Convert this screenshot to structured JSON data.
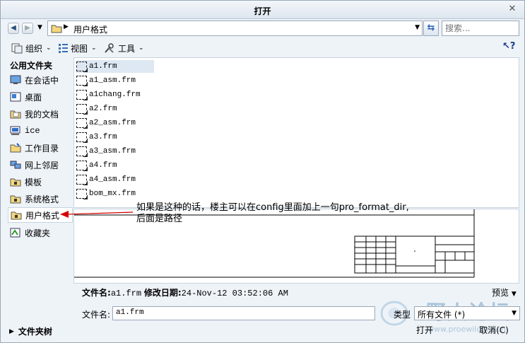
{
  "window": {
    "title": "打开"
  },
  "address": {
    "path": "用户格式"
  },
  "search": {
    "placeholder": "搜索..."
  },
  "toolbar": {
    "organize": "组织",
    "view": "视图",
    "tools": "工具"
  },
  "sidebar": {
    "header": "公用文件夹",
    "items": [
      {
        "label": "在会话中",
        "icon": "monitor-icon"
      },
      {
        "label": "桌面",
        "icon": "desktop-icon"
      },
      {
        "label": "我的文档",
        "icon": "documents-folder-icon"
      },
      {
        "label": "ice",
        "icon": "computer-icon"
      },
      {
        "label": "工作目录",
        "icon": "working-folder-icon"
      },
      {
        "label": "网上邻居",
        "icon": "network-icon"
      },
      {
        "label": "模板",
        "icon": "folder-icon"
      },
      {
        "label": "系统格式",
        "icon": "folder-icon"
      },
      {
        "label": "用户格式",
        "icon": "folder-icon",
        "selected": true
      },
      {
        "label": "收藏夹",
        "icon": "favorites-icon"
      }
    ],
    "folder_tree": "文件夹树"
  },
  "files": [
    {
      "name": "a1.frm",
      "selected": true
    },
    {
      "name": "a1_asm.frm"
    },
    {
      "name": "a1chang.frm"
    },
    {
      "name": "a2.frm"
    },
    {
      "name": "a2_asm.frm"
    },
    {
      "name": "a3.frm"
    },
    {
      "name": "a3_asm.frm"
    },
    {
      "name": "a4.frm"
    },
    {
      "name": "a4_asm.frm"
    },
    {
      "name": "bom_mx.frm"
    }
  ],
  "info": {
    "filename_label": "文件名:",
    "filename_value": "a1.frm",
    "date_label": "修改日期:",
    "date_value": "24-Nov-12 03:52:06 AM",
    "preview_label": "预览"
  },
  "bottom": {
    "filename_label": "文件名:",
    "filename_value": "a1.frm",
    "type_label": "类型",
    "type_value": "所有文件 (*)",
    "open_label": "打开",
    "cancel_label": "取消(C)"
  },
  "annotation": {
    "line1": "如果是这种的话，楼主可以在config里面加上一句pro_format_dir,",
    "line2": "后面是路径",
    "color": "#d40000"
  },
  "watermark": {
    "text": "野火论坛",
    "url": "www.proewildfire.cn"
  }
}
